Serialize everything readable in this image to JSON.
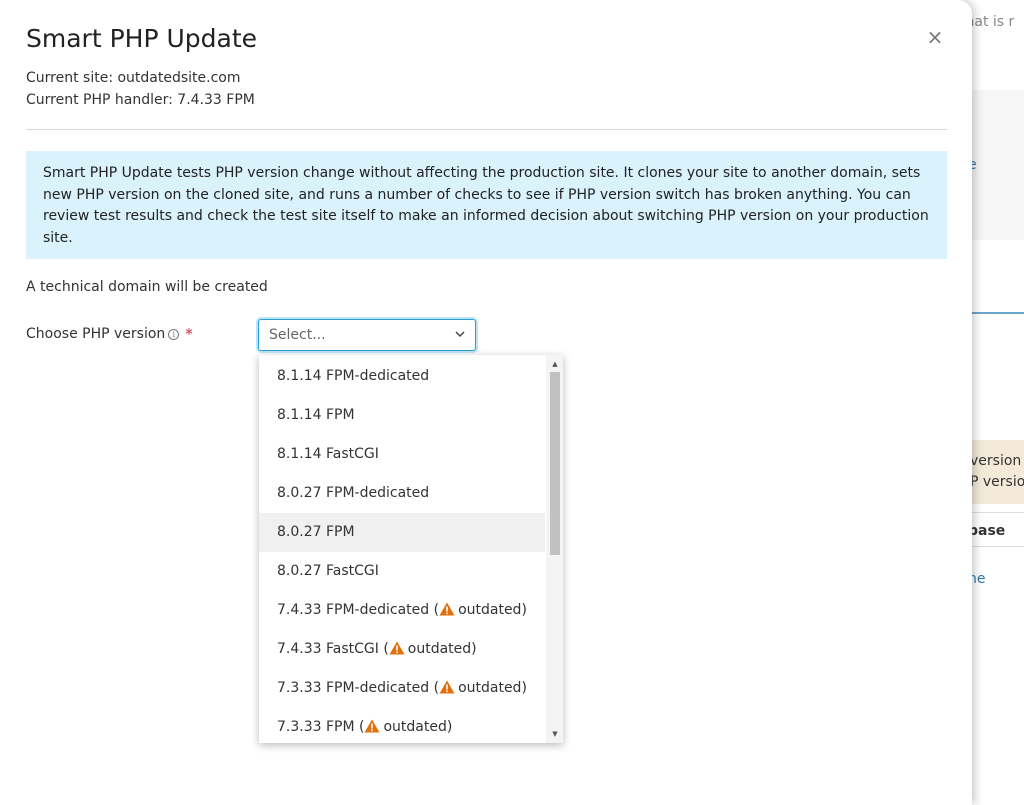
{
  "background": {
    "top_fragment": "that is r",
    "link_fragment": "e",
    "version_line1": "version",
    "version_line2": "P version",
    "base_label": "base",
    "link2_fragment": "ne"
  },
  "dialog": {
    "title": "Smart PHP Update",
    "close_glyph": "×",
    "current_site": "Current site: outdatedsite.com",
    "current_handler": "Current PHP handler: 7.4.33 FPM",
    "info_text": "Smart PHP Update tests PHP version change without affecting the production site. It clones your site to another domain, sets new PHP version on the cloned site, and runs a number of checks to see if PHP version switch has broken anything. You can review test results and check the test site itself to make an informed decision about switching PHP version on your production site.",
    "technical_domain_note": "A technical domain will be created",
    "choose_label": "Choose PHP version",
    "hint_glyph": "i",
    "required_mark": "*",
    "select_placeholder": "Select...",
    "options": [
      {
        "text": "8.1.14 FPM-dedicated"
      },
      {
        "text": "8.1.14 FPM"
      },
      {
        "text": "8.1.14 FastCGI"
      },
      {
        "text": "8.0.27 FPM-dedicated"
      },
      {
        "text": "8.0.27 FPM"
      },
      {
        "text": "8.0.27 FastCGI"
      },
      {
        "text": "7.4.33 FPM-dedicated (",
        "tag": "outdated)"
      },
      {
        "text": "7.4.33 FastCGI (",
        "tag": "outdated)"
      },
      {
        "text": "7.3.33 FPM-dedicated (",
        "tag": "outdated)"
      },
      {
        "text": "7.3.33 FPM (",
        "tag": "outdated)"
      }
    ],
    "highlighted_option": "8.0.27 FPM"
  },
  "colors": {
    "info_bg": "#d9f2fc",
    "focus_border": "#28a0d6",
    "warning": "#e36f0c",
    "required": "#d3293a"
  }
}
